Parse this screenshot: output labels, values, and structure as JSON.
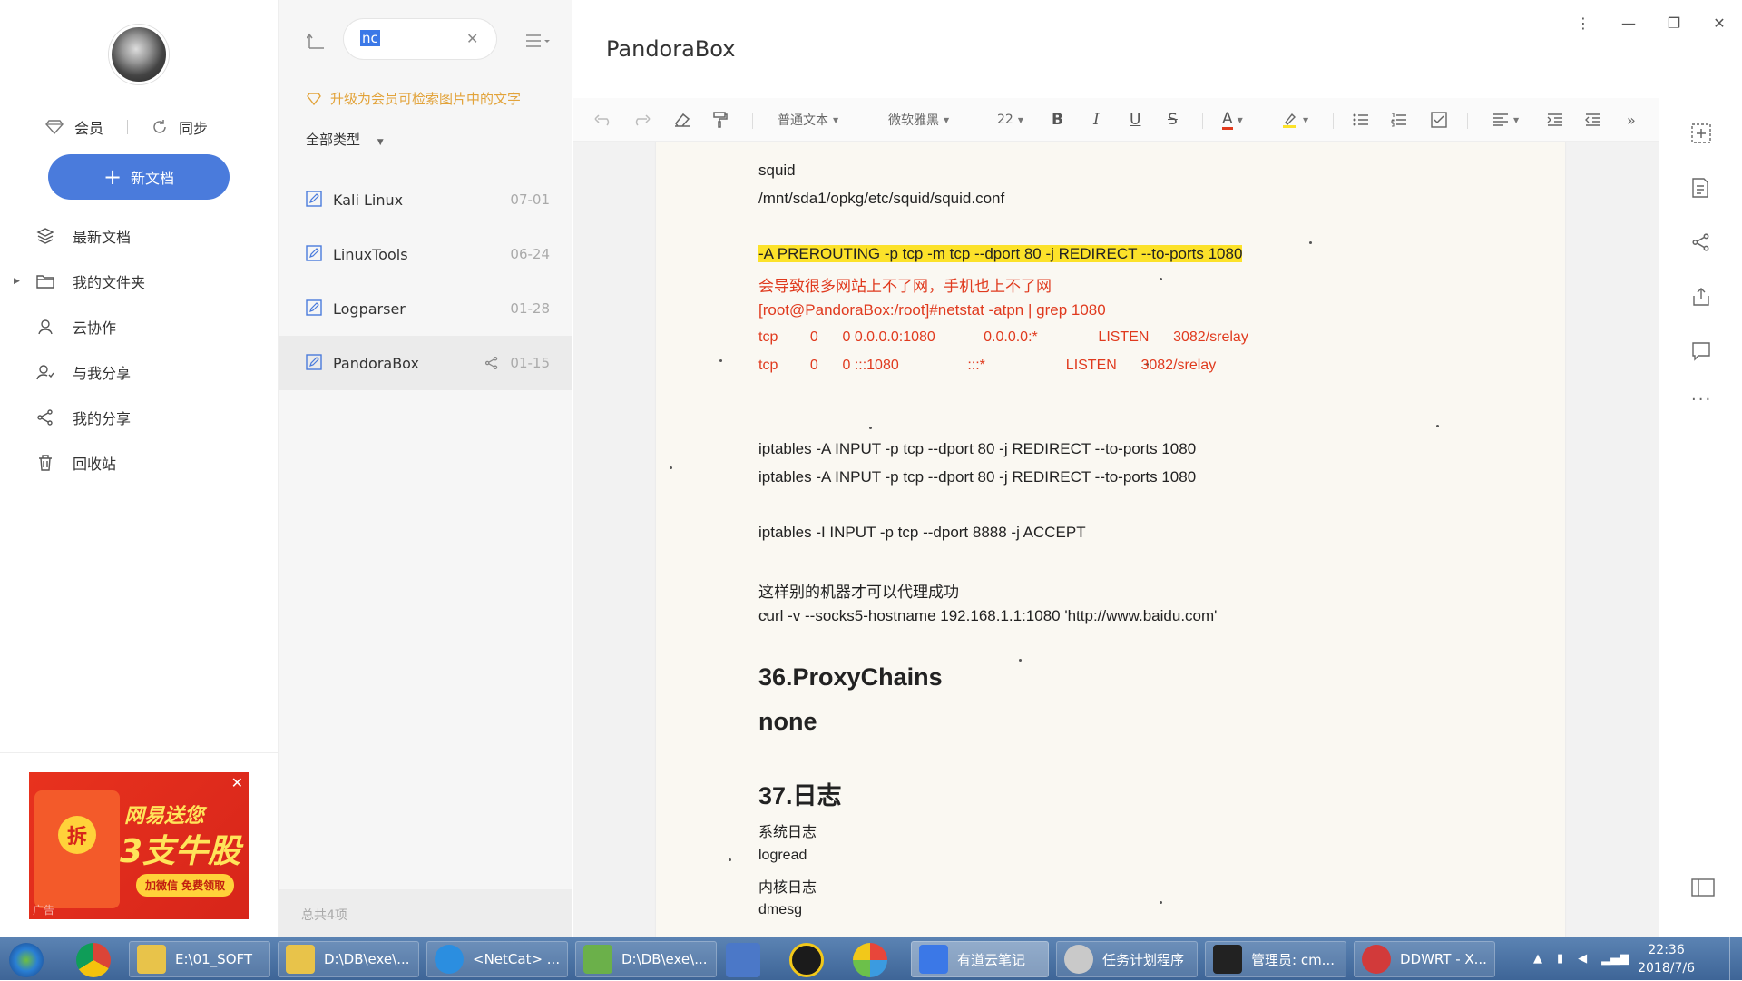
{
  "sidebar": {
    "member_label": "会员",
    "sync_label": "同步",
    "new_doc_label": "新文档",
    "nav": [
      {
        "label": "最新文档",
        "icon": "layers-icon"
      },
      {
        "label": "我的文件夹",
        "icon": "folder-icon"
      },
      {
        "label": "云协作",
        "icon": "user-icon"
      },
      {
        "label": "与我分享",
        "icon": "users-icon"
      },
      {
        "label": "我的分享",
        "icon": "share-icon"
      },
      {
        "label": "回收站",
        "icon": "trash-icon"
      }
    ],
    "ad": {
      "coin": "拆",
      "line1": "网易送您",
      "line2": "3支牛股",
      "button": "加微信 免费领取",
      "tag": "广告"
    }
  },
  "list": {
    "search_value": "nc",
    "upgrade_text": "升级为会员可检索图片中的文字",
    "type_filter": "全部类型",
    "notes": [
      {
        "title": "Kali Linux",
        "date": "07-01"
      },
      {
        "title": "LinuxTools",
        "date": "06-24"
      },
      {
        "title": "Logparser",
        "date": "01-28"
      },
      {
        "title": "PandoraBox",
        "date": "01-15"
      }
    ],
    "total": "总共4项"
  },
  "editor": {
    "title": "PandoraBox",
    "toolbar": {
      "paragraph_style": "普通文本",
      "font_family": "微软雅黑",
      "font_size": "22",
      "bold": "B",
      "italic": "I",
      "underline": "U",
      "strike": "S",
      "font_color": "A"
    },
    "content": {
      "l1": "squid",
      "l2": "/mnt/sda1/opkg/etc/squid/squid.conf",
      "l3": "-A PREROUTING -p tcp -m tcp --dport 80 -j REDIRECT --to-ports 1080",
      "l4": "会导致很多网站上不了网，手机也上不了网",
      "l5": "[root@PandoraBox:/root]#netstat -atpn | grep 1080",
      "l6": "tcp        0      0 0.0.0.0:1080            0.0.0.0:*               LISTEN      3082/srelay",
      "l7": "tcp        0      0 :::1080                 :::*                    LISTEN      3082/srelay",
      "l8": "iptables -A INPUT -p tcp --dport 80 -j REDIRECT --to-ports 1080",
      "l9": "iptables -A INPUT -p tcp --dport 80 -j REDIRECT --to-ports 1080",
      "l10": "iptables -I INPUT -p tcp --dport 8888 -j ACCEPT",
      "l11": "这样别的机器才可以代理成功",
      "l12": "curl -v --socks5-hostname 192.168.1.1:1080 'http://www.baidu.com'",
      "h1": "36.ProxyChains",
      "h2": "none",
      "h3": "37.日志",
      "l13": "系统日志",
      "l14": "logread",
      "l15": "内核日志",
      "l16": "dmesg"
    }
  },
  "taskbar": {
    "tasks": [
      {
        "label": "E:\\01_SOFT",
        "color": "#e8c34a"
      },
      {
        "label": "D:\\DB\\exe\\...",
        "color": "#e8c34a"
      },
      {
        "label": "<NetCat> ...",
        "color": "#2b8ee0"
      },
      {
        "label": "D:\\DB\\exe\\...",
        "color": "#6bb04a"
      },
      {
        "label": "有道云笔记",
        "color": "#3b78e7"
      },
      {
        "label": "任务计划程序",
        "color": "#c9c9c9"
      },
      {
        "label": "管理员: cm...",
        "color": "#222222"
      },
      {
        "label": "DDWRT - X...",
        "color": "#d23a3a"
      }
    ],
    "time": "22:36",
    "date": "2018/7/6"
  }
}
